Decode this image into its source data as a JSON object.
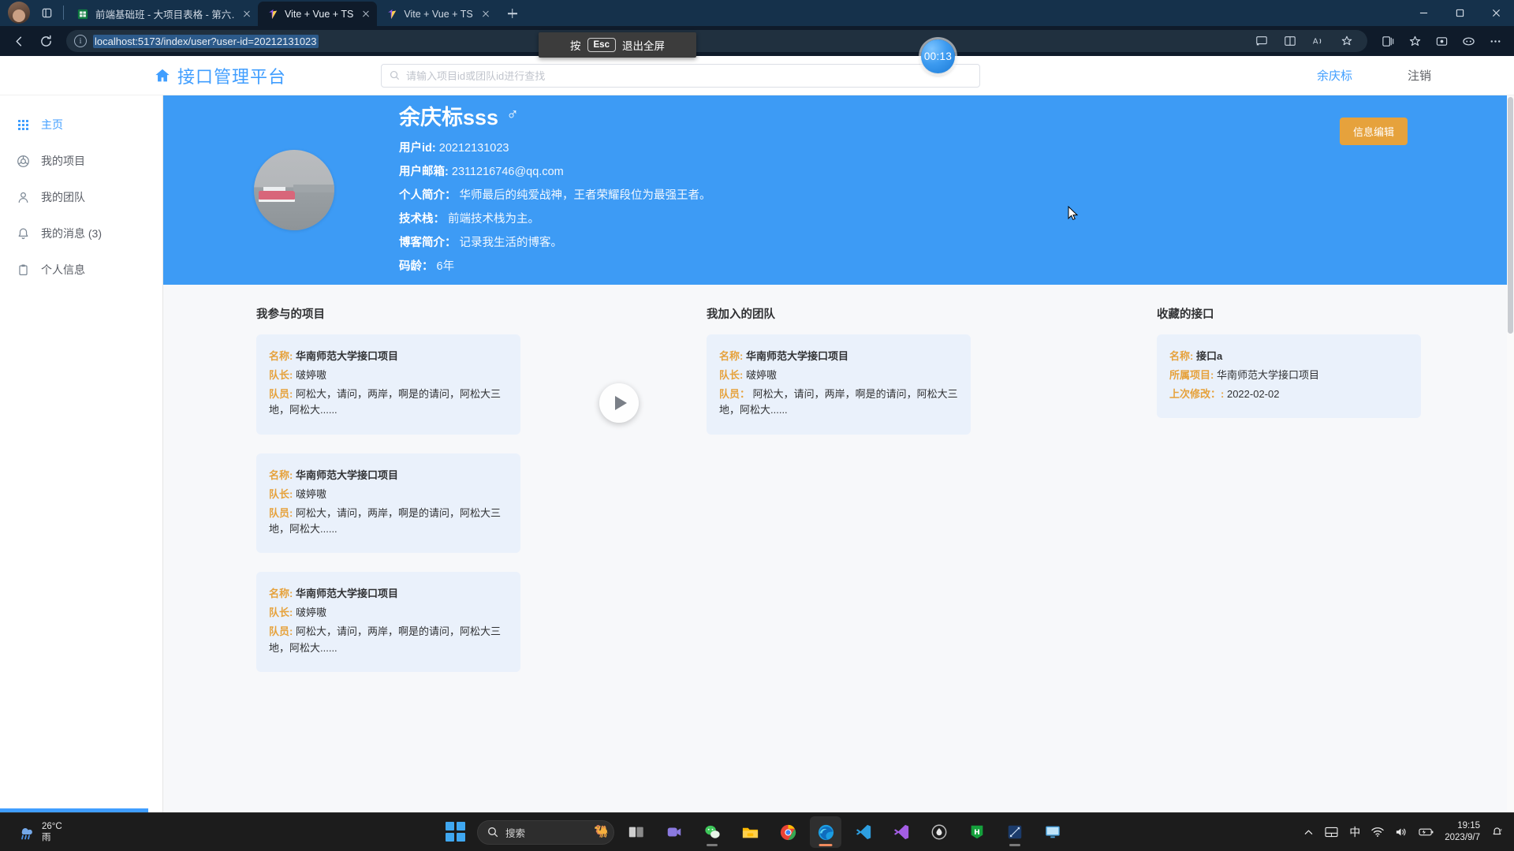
{
  "browser": {
    "tabs": [
      {
        "title": "前端基础班 - 大项目表格 - 第六…",
        "favicon": "spreadsheet-icon",
        "active": false
      },
      {
        "title": "Vite + Vue + TS",
        "favicon": "vite-icon",
        "active": true
      },
      {
        "title": "Vite + Vue + TS",
        "favicon": "vite-icon",
        "active": false
      }
    ],
    "new_tab_label": "+",
    "window_controls": {
      "minimize": "—",
      "maximize": "▢",
      "close": "✕"
    },
    "nav": {
      "back": "←",
      "reload": "⟳",
      "info": "i"
    },
    "url": "localhost:5173/index/user?user-id=20212131023",
    "omnibox_right_icons": [
      "cast-icon",
      "split-screen-icon",
      "read-aloud-icon",
      "favorite-star-icon"
    ],
    "toolbar_right_icons": [
      "collections-icon",
      "favorites-icon",
      "browser-essentials-icon",
      "copilot-icon",
      "settings-more-icon"
    ],
    "fullscreen_toast": {
      "prefix": "按",
      "key": "Esc",
      "suffix": "退出全屏"
    },
    "recording_badge": "00:13"
  },
  "app": {
    "brand": {
      "icon": "home-icon",
      "text": "接口管理平台"
    },
    "search": {
      "icon": "search-icon",
      "placeholder": "请输入项目id或团队id进行查找",
      "value": ""
    },
    "header_right": {
      "user": "余庆标",
      "logout": "注销"
    }
  },
  "sidebar": {
    "items": [
      {
        "label": "主页",
        "icon": "grid-icon",
        "active": true
      },
      {
        "label": "我的项目",
        "icon": "chrome-circle-icon",
        "active": false
      },
      {
        "label": "我的团队",
        "icon": "user-icon",
        "active": false
      },
      {
        "label": "我的消息 (3)",
        "icon": "bell-icon",
        "active": false
      },
      {
        "label": "个人信息",
        "icon": "clipboard-icon",
        "active": false
      }
    ]
  },
  "profile": {
    "avatar_alt": "user-avatar-photo",
    "name": "余庆标sss",
    "gender_symbol": "♂",
    "fields": [
      {
        "label": "用户id:",
        "value": "20212131023"
      },
      {
        "label": "用户邮箱:",
        "value": "2311216746@qq.com"
      },
      {
        "label": "个人简介：",
        "value": "华师最后的纯爱战神，王者荣耀段位为最强王者。"
      },
      {
        "label": "技术栈：",
        "value": "前端技术栈为主。"
      },
      {
        "label": "博客简介：",
        "value": "记录我生活的博客。"
      },
      {
        "label": "码龄：",
        "value": "6年"
      }
    ],
    "edit_button": "信息编辑"
  },
  "columns": [
    {
      "title": "我参与的项目",
      "cards": [
        {
          "rows": [
            {
              "k": "名称:",
              "v": "华南师范大学接口项目",
              "bold": true
            },
            {
              "k": "队长:",
              "v": "啵婷嗷",
              "bold": false
            },
            {
              "k": "队员:",
              "v": "阿松大，请问，两岸，啊是的请问，阿松大三地，阿松大......",
              "bold": false
            }
          ]
        },
        {
          "rows": [
            {
              "k": "名称:",
              "v": "华南师范大学接口项目",
              "bold": true
            },
            {
              "k": "队长:",
              "v": "啵婷嗷",
              "bold": false
            },
            {
              "k": "队员:",
              "v": "阿松大，请问，两岸，啊是的请问，阿松大三地，阿松大......",
              "bold": false
            }
          ]
        },
        {
          "rows": [
            {
              "k": "名称:",
              "v": "华南师范大学接口项目",
              "bold": true
            },
            {
              "k": "队长:",
              "v": "啵婷嗷",
              "bold": false
            },
            {
              "k": "队员:",
              "v": "阿松大，请问，两岸，啊是的请问，阿松大三地，阿松大......",
              "bold": false
            }
          ]
        }
      ]
    },
    {
      "title": "我加入的团队",
      "cards": [
        {
          "rows": [
            {
              "k": "名称:",
              "v": "华南师范大学接口项目",
              "bold": true
            },
            {
              "k": "队长:",
              "v": "啵婷嗷",
              "bold": false
            },
            {
              "k": "队员：",
              "v": "阿松大，请问，两岸，啊是的请问，阿松大三地，阿松大......",
              "bold": false
            }
          ]
        }
      ]
    },
    {
      "title": "收藏的接口",
      "cards": [
        {
          "rows": [
            {
              "k": "名称:",
              "v": "接口a",
              "bold": true
            },
            {
              "k": "所属项目:",
              "v": "华南师范大学接口项目",
              "bold": false
            },
            {
              "k": "上次修改：:",
              "v": "2022-02-02",
              "bold": false
            }
          ]
        }
      ]
    }
  ],
  "video_overlay": {
    "icon": "play-icon"
  },
  "taskbar": {
    "weather": {
      "temp": "26°C",
      "cond": "雨",
      "icon": "rain-icon"
    },
    "start_label": "start-icon",
    "search": {
      "icon": "search-icon",
      "placeholder": "搜索"
    },
    "apps": [
      {
        "name": "task-view-icon",
        "glyph": "❐",
        "active": false,
        "running": false
      },
      {
        "name": "teams-icon",
        "glyph": "◩",
        "active": false,
        "running": false
      },
      {
        "name": "wechat-icon",
        "glyph": "💬",
        "active": false,
        "running": true
      },
      {
        "name": "file-explorer-icon",
        "glyph": "📁",
        "active": false,
        "running": false
      },
      {
        "name": "chrome-icon",
        "glyph": "◎",
        "active": false,
        "running": false
      },
      {
        "name": "edge-icon",
        "glyph": "◉",
        "active": true,
        "running": true
      },
      {
        "name": "vscode-icon",
        "glyph": "✖",
        "active": false,
        "running": false
      },
      {
        "name": "visual-studio-icon",
        "glyph": "✖",
        "active": false,
        "running": false
      },
      {
        "name": "apifox-icon",
        "glyph": "◍",
        "active": false,
        "running": false
      },
      {
        "name": "hbuilder-icon",
        "glyph": "H",
        "active": false,
        "running": false
      },
      {
        "name": "navicat-icon",
        "glyph": "◪",
        "active": false,
        "running": true
      },
      {
        "name": "remote-desktop-icon",
        "glyph": "🖥",
        "active": false,
        "running": false
      }
    ],
    "tray": {
      "overflow": "^",
      "icons": [
        "touchpad-icon",
        "ime-chinese-icon",
        "wifi-icon",
        "volume-icon",
        "battery-icon"
      ],
      "ime_label": "中",
      "time": "19:15",
      "date": "2023/9/7",
      "notification": "bell-sleep-icon"
    }
  }
}
